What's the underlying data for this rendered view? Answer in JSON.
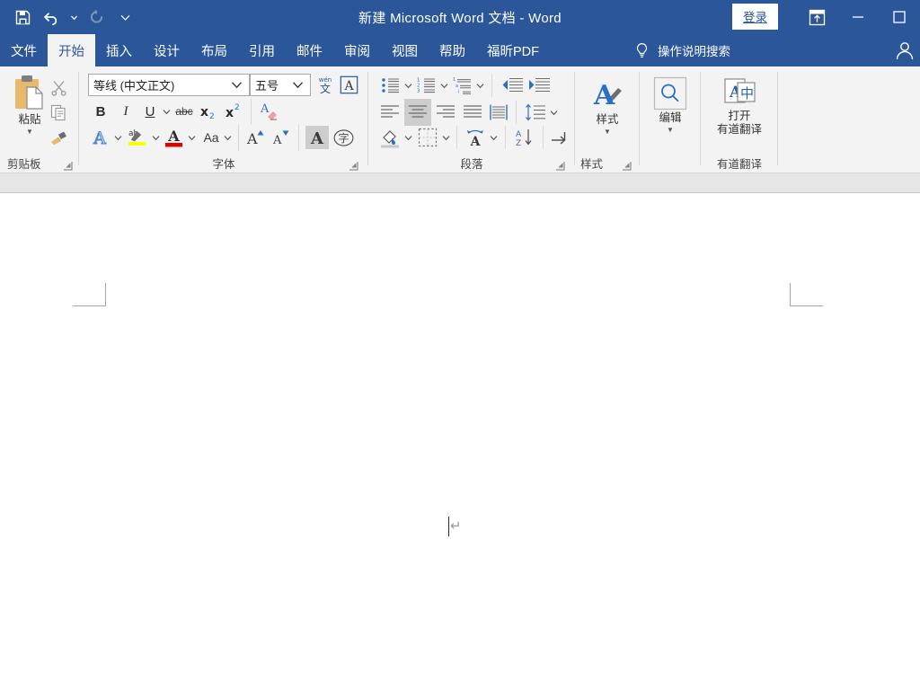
{
  "window": {
    "title": "新建 Microsoft Word 文档  -  Word",
    "title_bar_color": "#2b579a",
    "quick_access": [
      {
        "name": "save",
        "icon": "save-icon",
        "tooltip": "保存"
      },
      {
        "name": "undo",
        "icon": "undo-icon",
        "tooltip": "撤消"
      },
      {
        "name": "redo",
        "icon": "redo-icon",
        "tooltip": "恢复"
      },
      {
        "name": "customize",
        "icon": "chevron-down-icon",
        "tooltip": "自定义快速访问工具栏"
      }
    ],
    "signin_label": "登录",
    "ribbon_display_options": "功能区显示选项",
    "minimize": "最小化",
    "maximize": "最大化"
  },
  "tabs": [
    {
      "label": "文件",
      "active": false
    },
    {
      "label": "开始",
      "active": true
    },
    {
      "label": "插入",
      "active": false
    },
    {
      "label": "设计",
      "active": false
    },
    {
      "label": "布局",
      "active": false
    },
    {
      "label": "引用",
      "active": false
    },
    {
      "label": "邮件",
      "active": false
    },
    {
      "label": "审阅",
      "active": false
    },
    {
      "label": "视图",
      "active": false
    },
    {
      "label": "帮助",
      "active": false
    },
    {
      "label": "福昕PDF",
      "active": false
    }
  ],
  "tellme": {
    "label": "操作说明搜索",
    "icon": "lightbulb-icon"
  },
  "account": {
    "icon": "person-icon"
  },
  "ribbon": {
    "groups": [
      {
        "id": "clipboard",
        "label": "剪贴板",
        "has_launcher": true,
        "items": [
          {
            "name": "paste",
            "label": "粘贴",
            "has_menu": true
          },
          {
            "name": "cut",
            "label": "剪切"
          },
          {
            "name": "copy",
            "label": "复制"
          },
          {
            "name": "format-painter",
            "label": "格式刷"
          }
        ]
      },
      {
        "id": "font",
        "label": "字体",
        "has_launcher": true,
        "font_name": "等线 (中文正文)",
        "font_size": "五号",
        "items": [
          {
            "name": "phonetic-guide",
            "label": "拼音指南"
          },
          {
            "name": "character-border",
            "label": "字符边框"
          },
          {
            "name": "bold",
            "label": "B"
          },
          {
            "name": "italic",
            "label": "I"
          },
          {
            "name": "underline",
            "label": "U",
            "has_menu": true
          },
          {
            "name": "strikethrough",
            "label": "abc"
          },
          {
            "name": "subscript",
            "label": "x₂"
          },
          {
            "name": "superscript",
            "label": "x²"
          },
          {
            "name": "clear-formatting",
            "label": "清除所有格式"
          },
          {
            "name": "text-effects",
            "label": "文本效果和版式",
            "has_menu": true
          },
          {
            "name": "text-highlight-color",
            "label": "以不同颜色突出显示文本",
            "has_menu": true,
            "color": "#ffff00"
          },
          {
            "name": "font-color",
            "label": "字体颜色",
            "has_menu": true,
            "color": "#e00000"
          },
          {
            "name": "change-case",
            "label": "Aa",
            "has_menu": true
          },
          {
            "name": "grow-font",
            "label": "增大字号"
          },
          {
            "name": "shrink-font",
            "label": "减小字号"
          },
          {
            "name": "character-shading",
            "label": "字符底纹",
            "active": true
          },
          {
            "name": "enclose-characters",
            "label": "带圈字符"
          }
        ]
      },
      {
        "id": "paragraph",
        "label": "段落",
        "has_launcher": true,
        "items": [
          {
            "name": "bullets",
            "label": "项目符号",
            "has_menu": true
          },
          {
            "name": "numbering",
            "label": "编号",
            "has_menu": true
          },
          {
            "name": "multilevel-list",
            "label": "多级列表",
            "has_menu": true
          },
          {
            "name": "decrease-indent",
            "label": "减少缩进量"
          },
          {
            "name": "increase-indent",
            "label": "增加缩进量"
          },
          {
            "name": "align-left",
            "label": "左对齐"
          },
          {
            "name": "align-center",
            "label": "居中",
            "active": true
          },
          {
            "name": "align-right",
            "label": "右对齐"
          },
          {
            "name": "justify",
            "label": "两端对齐"
          },
          {
            "name": "distribute",
            "label": "分散对齐"
          },
          {
            "name": "line-spacing",
            "label": "行和段落间距",
            "has_menu": true
          },
          {
            "name": "shading",
            "label": "底纹",
            "has_menu": true
          },
          {
            "name": "borders",
            "label": "边框",
            "has_menu": true
          },
          {
            "name": "asian-layout",
            "label": "中文版式",
            "has_menu": true
          },
          {
            "name": "sort",
            "label": "排序"
          },
          {
            "name": "show-formatting-marks",
            "label": "显示/隐藏编辑标记"
          }
        ]
      },
      {
        "id": "styles",
        "label": "样式",
        "has_launcher": true,
        "items": [
          {
            "name": "styles",
            "label": "样式",
            "has_menu": true
          }
        ]
      },
      {
        "id": "editing",
        "label": "",
        "has_launcher": false,
        "items": [
          {
            "name": "editing",
            "label": "编辑",
            "has_menu": true
          }
        ]
      },
      {
        "id": "youdao",
        "label": "有道翻译",
        "has_launcher": false,
        "items": [
          {
            "name": "open-youdao",
            "label_line1": "打开",
            "label_line2": "有道翻译"
          }
        ]
      }
    ]
  },
  "document": {
    "paragraph_mark": "↵",
    "caret_visible": true,
    "page_background": "#ffffff"
  }
}
